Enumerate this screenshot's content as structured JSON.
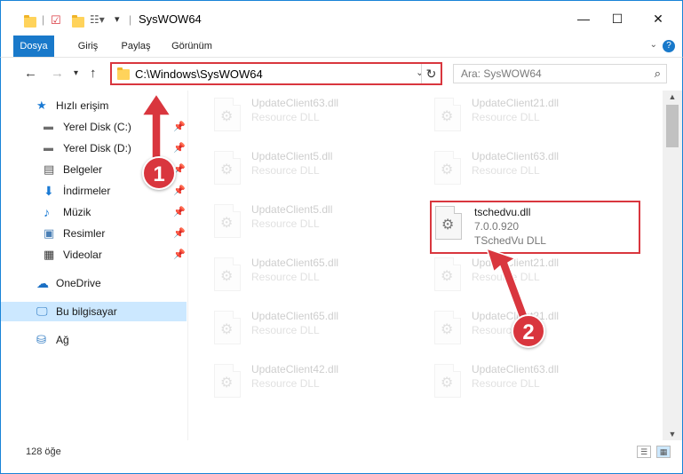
{
  "window": {
    "title": "SysWOW64",
    "minimize_icon": "minimize-icon",
    "maximize_icon": "maximize-icon",
    "close_icon": "close-icon"
  },
  "ribbon": {
    "tabs": [
      {
        "label": "Dosya"
      },
      {
        "label": "Giriş"
      },
      {
        "label": "Paylaş"
      },
      {
        "label": "Görünüm"
      }
    ],
    "accent": "#1979ca"
  },
  "address": {
    "path": "C:\\Windows\\SysWOW64"
  },
  "search": {
    "placeholder": "Ara: SysWOW64"
  },
  "nav": {
    "items": [
      {
        "label": "Hızlı erişim",
        "icon": "star-icon"
      },
      {
        "label": "Yerel Disk (C:)",
        "icon": "drive-icon",
        "pinned": true
      },
      {
        "label": "Yerel Disk (D:)",
        "icon": "drive-icon",
        "pinned": true
      },
      {
        "label": "Belgeler",
        "icon": "document-icon",
        "pinned": true
      },
      {
        "label": "İndirmeler",
        "icon": "download-icon",
        "pinned": true
      },
      {
        "label": "Müzik",
        "icon": "music-icon",
        "pinned": true
      },
      {
        "label": "Resimler",
        "icon": "pictures-icon",
        "pinned": true
      },
      {
        "label": "Videolar",
        "icon": "video-icon",
        "pinned": true
      },
      {
        "label": "OneDrive",
        "icon": "cloud-icon"
      },
      {
        "label": "Bu bilgisayar",
        "icon": "computer-icon",
        "selected": true
      },
      {
        "label": "Ağ",
        "icon": "network-icon"
      }
    ]
  },
  "files": [
    {
      "name": "UpdateClient63.dll",
      "desc": "Resource DLL"
    },
    {
      "name": "UpdateClient21.dll",
      "desc": "Resource DLL"
    },
    {
      "name": "UpdateClient5.dll",
      "desc": "Resource DLL"
    },
    {
      "name": "UpdateClient63.dll",
      "desc": "Resource DLL"
    },
    {
      "name": "UpdateClient5.dll",
      "desc": "Resource DLL"
    },
    {
      "name": "tschedvu.dll",
      "version": "7.0.0.920",
      "desc": "TSchedVu DLL"
    },
    {
      "name": "UpdateClient65.dll",
      "desc": "Resource DLL"
    },
    {
      "name": "UpdateClient21.dll",
      "desc": "Resource DLL"
    },
    {
      "name": "UpdateClient65.dll",
      "desc": "Resource DLL"
    },
    {
      "name": "UpdateClient21.dll",
      "desc": "Resource DLL"
    },
    {
      "name": "UpdateClient42.dll",
      "desc": "Resource DLL"
    },
    {
      "name": "UpdateClient63.dll",
      "desc": "Resource DLL"
    }
  ],
  "status": {
    "count": "128 öğe"
  },
  "annotations": {
    "step1": "1",
    "step2": "2",
    "color": "#d9363e"
  }
}
